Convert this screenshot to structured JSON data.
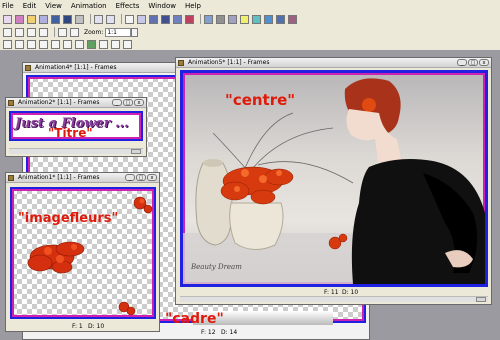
{
  "menu": [
    "File",
    "Edit",
    "View",
    "Animation",
    "Effects",
    "Window",
    "Help"
  ],
  "toolbar": {
    "zoom_label": "Zoom:",
    "zoom_value": "1:1"
  },
  "windows": {
    "anim4": {
      "title": "Animation4* [1:1] - Frames",
      "frame_f": "F: 12",
      "frame_d": "D: 14"
    },
    "anim2": {
      "title": "Animation2* [1:1] - Frames",
      "caption": "\"Titre\"",
      "script_text": "Just a Flower ..."
    },
    "anim1": {
      "title": "Animation1* [1:1] - Frames",
      "caption": "\"imagefleurs\"",
      "frame_f": "F: 1",
      "frame_d": "D: 10"
    },
    "anim5": {
      "title": "Animation5* [1:1] - Frames",
      "caption": "\"centre\"",
      "signature": "Beauty Dream",
      "frame_f": "F: 11",
      "frame_d": "D: 10"
    }
  },
  "desktop": {
    "cadre_label": "\"cadre\""
  },
  "colors": {
    "accent_red": "#e01a0a",
    "frame_blue": "#2020e0",
    "frame_magenta": "#d020b0"
  }
}
